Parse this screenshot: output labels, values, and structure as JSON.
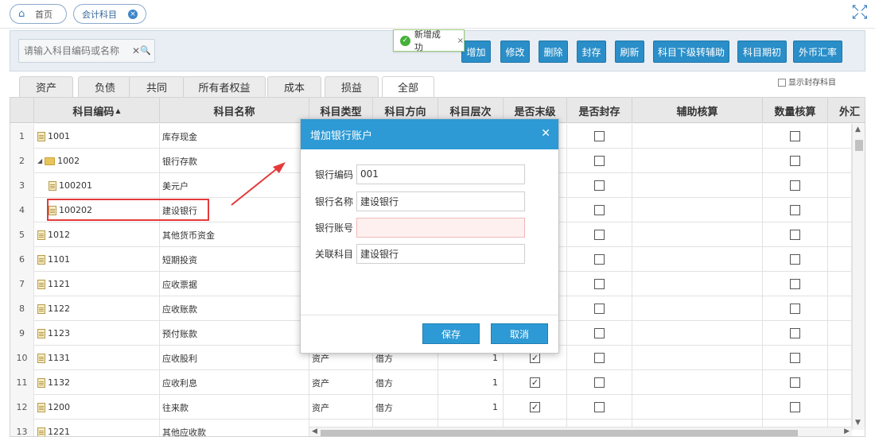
{
  "nav": {
    "home_label": "首页",
    "active_tab_label": "会计科目"
  },
  "toolbar": {
    "search_placeholder": "请输入科目编码或名称",
    "buttons": [
      "增加",
      "修改",
      "删除",
      "封存",
      "刷新",
      "科目下级转辅助",
      "科目期初",
      "外币汇率"
    ]
  },
  "toast": {
    "message": "新增成功"
  },
  "category_tabs": [
    "资产",
    "负债",
    "共同",
    "所有者权益",
    "成本",
    "损益",
    "全部"
  ],
  "active_category": "全部",
  "show_sealed_label": "显示封存科目",
  "grid": {
    "columns": [
      "科目编码",
      "科目名称",
      "科目类型",
      "科目方向",
      "科目层次",
      "是否末级",
      "是否封存",
      "辅助核算",
      "数量核算",
      "外汇"
    ],
    "sort_indicator": "▲",
    "rows": [
      {
        "num": "1",
        "code": "1001",
        "name": "库存现金",
        "type": "",
        "dir": "",
        "level": "",
        "leaf": false,
        "sealed": false,
        "qty": false,
        "is_folder": false,
        "indent": 0
      },
      {
        "num": "2",
        "code": "1002",
        "name": "银行存款",
        "type": "",
        "dir": "",
        "level": "",
        "leaf": false,
        "sealed": false,
        "qty": false,
        "is_folder": true,
        "indent": 0
      },
      {
        "num": "3",
        "code": "100201",
        "name": "美元户",
        "type": "",
        "dir": "",
        "level": "",
        "leaf": false,
        "sealed": false,
        "qty": false,
        "is_folder": false,
        "indent": 1
      },
      {
        "num": "4",
        "code": "100202",
        "name": "建设银行",
        "type": "",
        "dir": "",
        "level": "",
        "leaf": false,
        "sealed": false,
        "qty": false,
        "is_folder": false,
        "indent": 1
      },
      {
        "num": "5",
        "code": "1012",
        "name": "其他货币资金",
        "type": "",
        "dir": "",
        "level": "",
        "leaf": false,
        "sealed": false,
        "qty": false,
        "is_folder": false,
        "indent": 0
      },
      {
        "num": "6",
        "code": "1101",
        "name": "短期投资",
        "type": "",
        "dir": "",
        "level": "",
        "leaf": false,
        "sealed": false,
        "qty": false,
        "is_folder": false,
        "indent": 0
      },
      {
        "num": "7",
        "code": "1121",
        "name": "应收票据",
        "type": "",
        "dir": "",
        "level": "",
        "leaf": false,
        "sealed": false,
        "qty": false,
        "is_folder": false,
        "indent": 0
      },
      {
        "num": "8",
        "code": "1122",
        "name": "应收账款",
        "type": "",
        "dir": "",
        "level": "",
        "leaf": false,
        "sealed": false,
        "qty": false,
        "is_folder": false,
        "indent": 0
      },
      {
        "num": "9",
        "code": "1123",
        "name": "预付账款",
        "type": "",
        "dir": "",
        "level": "",
        "leaf": false,
        "sealed": false,
        "qty": false,
        "is_folder": false,
        "indent": 0
      },
      {
        "num": "10",
        "code": "1131",
        "name": "应收股利",
        "type": "资产",
        "dir": "借方",
        "level": "1",
        "leaf": true,
        "sealed": false,
        "qty": false,
        "is_folder": false,
        "indent": 0
      },
      {
        "num": "11",
        "code": "1132",
        "name": "应收利息",
        "type": "资产",
        "dir": "借方",
        "level": "1",
        "leaf": true,
        "sealed": false,
        "qty": false,
        "is_folder": false,
        "indent": 0
      },
      {
        "num": "12",
        "code": "1200",
        "name": "往来款",
        "type": "资产",
        "dir": "借方",
        "level": "1",
        "leaf": true,
        "sealed": false,
        "qty": false,
        "is_folder": false,
        "indent": 0
      },
      {
        "num": "13",
        "code": "1221",
        "name": "其他应收款",
        "type": "",
        "dir": "",
        "level": "",
        "leaf": false,
        "sealed": false,
        "qty": false,
        "is_folder": false,
        "indent": 0
      }
    ]
  },
  "modal": {
    "title": "增加银行账户",
    "fields": [
      {
        "label": "银行编码",
        "value": "001"
      },
      {
        "label": "银行名称",
        "value": "建设银行"
      },
      {
        "label": "银行账号",
        "value": ""
      },
      {
        "label": "关联科目",
        "value": "建设银行"
      }
    ],
    "save_label": "保存",
    "cancel_label": "取消"
  },
  "colors": {
    "primary": "#2d9ad5",
    "toolbar_button": "#2a8ec8",
    "highlight": "#e53a3a",
    "success": "#46b03a"
  }
}
